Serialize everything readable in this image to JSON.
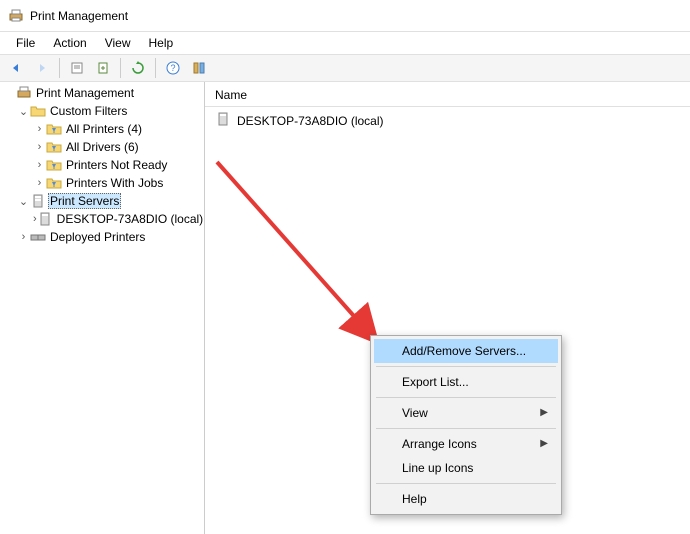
{
  "window": {
    "title": "Print Management"
  },
  "menubar": [
    "File",
    "Action",
    "View",
    "Help"
  ],
  "tree": {
    "root": "Print Management",
    "customFilters": {
      "label": "Custom Filters",
      "items": [
        "All Printers (4)",
        "All Drivers (6)",
        "Printers Not Ready",
        "Printers With Jobs"
      ]
    },
    "printServers": {
      "label": "Print Servers",
      "items": [
        "DESKTOP-73A8DIO (local)"
      ]
    },
    "deployedPrinters": "Deployed Printers"
  },
  "list": {
    "header": "Name",
    "items": [
      "DESKTOP-73A8DIO (local)"
    ]
  },
  "contextMenu": {
    "addRemove": "Add/Remove Servers...",
    "exportList": "Export List...",
    "view": "View",
    "arrangeIcons": "Arrange Icons",
    "lineUpIcons": "Line up Icons",
    "help": "Help"
  }
}
